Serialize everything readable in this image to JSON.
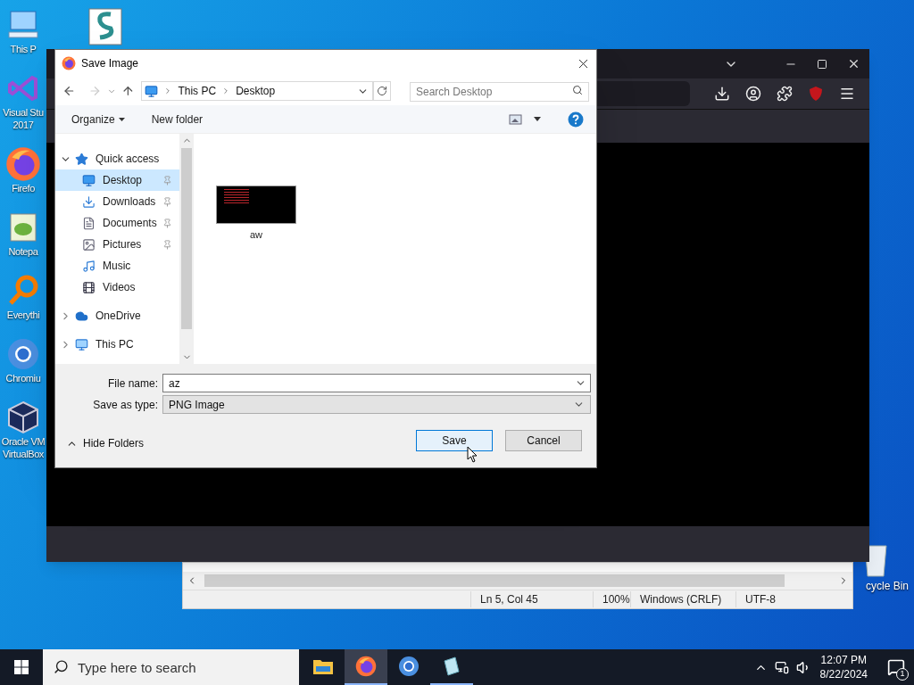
{
  "desktop_icons": [
    {
      "kind": "pc",
      "lines": [
        "This P"
      ]
    },
    {
      "kind": "vs",
      "lines": [
        "Visual Stu",
        "2017"
      ]
    },
    {
      "kind": "firefox",
      "lines": [
        "Firefo"
      ]
    },
    {
      "kind": "notepad",
      "lines": [
        "Notepa"
      ]
    },
    {
      "kind": "search",
      "lines": [
        "Everythi"
      ]
    },
    {
      "kind": "chromium",
      "lines": [
        "Chromiu"
      ]
    },
    {
      "kind": "virtualbox",
      "lines": [
        "Oracle VM",
        "VirtualBox"
      ]
    }
  ],
  "recycle_bin": {
    "label": "cycle Bin"
  },
  "notepad": {
    "status": [
      "Ln 5, Col 45",
      "100%",
      "Windows (CRLF)",
      "UTF-8"
    ]
  },
  "dialog": {
    "title": "Save Image",
    "breadcrumb": [
      "This PC",
      "Desktop"
    ],
    "search_placeholder": "Search Desktop",
    "toolbar": [
      "Organize",
      "New folder"
    ],
    "nav": [
      {
        "label": "Quick access",
        "kind": "star",
        "expanded": true,
        "selected": false,
        "children": [
          {
            "label": "Desktop",
            "kind": "desktop",
            "selected": true,
            "pinned": true
          },
          {
            "label": "Downloads",
            "kind": "download",
            "selected": false,
            "pinned": true
          },
          {
            "label": "Documents",
            "kind": "document",
            "selected": false,
            "pinned": true
          },
          {
            "label": "Pictures",
            "kind": "picture",
            "selected": false,
            "pinned": true
          },
          {
            "label": "Music",
            "kind": "music",
            "selected": false,
            "pinned": false
          },
          {
            "label": "Videos",
            "kind": "video",
            "selected": false,
            "pinned": false
          }
        ]
      },
      {
        "label": "OneDrive",
        "kind": "cloud",
        "expanded": false,
        "selected": false
      },
      {
        "label": "This PC",
        "kind": "pc",
        "expanded": false,
        "selected": false
      }
    ],
    "files": [
      {
        "name": "aw"
      }
    ],
    "file_name_label": "File name:",
    "file_name": "az",
    "type_label": "Save as type:",
    "save_as_type": "PNG Image",
    "hide_folders": "Hide Folders",
    "buttons": [
      {
        "label": "Save",
        "default": true
      },
      {
        "label": "Cancel",
        "default": false
      }
    ]
  },
  "taskbar": {
    "search_placeholder": "Type here to search",
    "apps": [
      {
        "kind": "explorer",
        "active": false,
        "running": false
      },
      {
        "kind": "firefox",
        "active": true,
        "running": true
      },
      {
        "kind": "chromium",
        "active": false,
        "running": false
      },
      {
        "kind": "notepad",
        "active": false,
        "running": true
      }
    ],
    "time": "12:07 PM",
    "date": "8/22/2024",
    "notifications": "1"
  }
}
